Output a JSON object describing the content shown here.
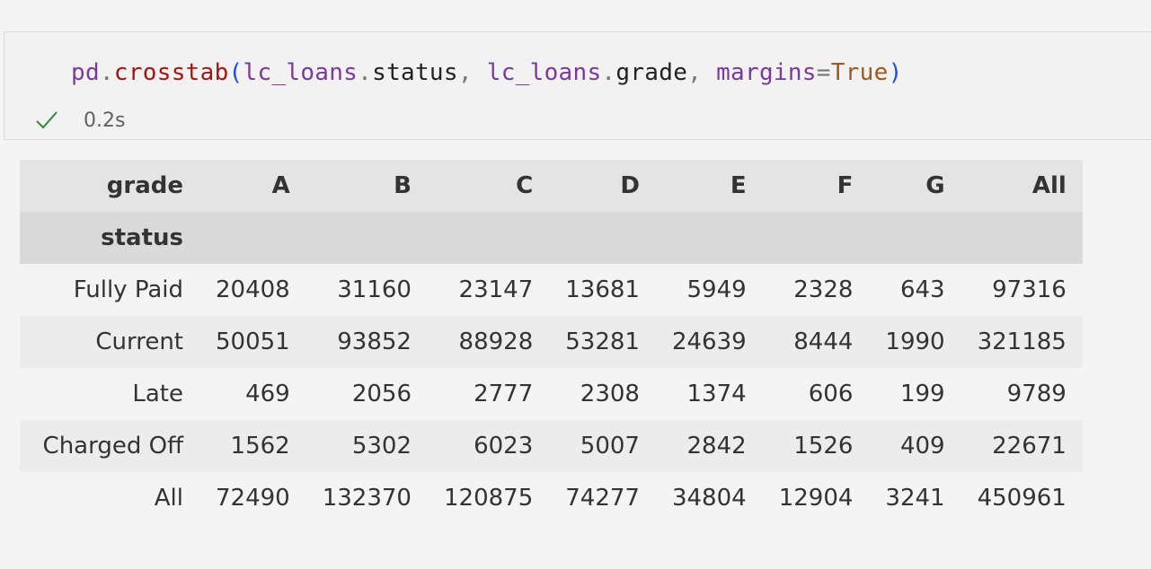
{
  "cell": {
    "code": {
      "obj": "pd",
      "dot1": ".",
      "func": "crosstab",
      "paren_open": "(",
      "arg1_obj": "lc_loans",
      "arg1_dot": ".",
      "arg1_attr": "status",
      "comma1": ", ",
      "arg2_obj": "lc_loans",
      "arg2_dot": ".",
      "arg2_attr": "grade",
      "comma2": ", ",
      "kwarg": "margins",
      "eq": "=",
      "kwval": "True",
      "paren_close": ")"
    },
    "status": {
      "icon": "check-icon",
      "timing": "0.2s"
    }
  },
  "table": {
    "col_index_label": "grade",
    "row_index_label": "status",
    "columns": [
      "A",
      "B",
      "C",
      "D",
      "E",
      "F",
      "G",
      "All"
    ],
    "rows": [
      {
        "label": "Fully Paid",
        "values": [
          "20408",
          "31160",
          "23147",
          "13681",
          "5949",
          "2328",
          "643",
          "97316"
        ]
      },
      {
        "label": "Current",
        "values": [
          "50051",
          "93852",
          "88928",
          "53281",
          "24639",
          "8444",
          "1990",
          "321185"
        ]
      },
      {
        "label": "Late",
        "values": [
          "469",
          "2056",
          "2777",
          "2308",
          "1374",
          "606",
          "199",
          "9789"
        ]
      },
      {
        "label": "Charged Off",
        "values": [
          "1562",
          "5302",
          "6023",
          "5007",
          "2842",
          "1526",
          "409",
          "22671"
        ]
      },
      {
        "label": "All",
        "values": [
          "72490",
          "132370",
          "120875",
          "74277",
          "34804",
          "12904",
          "3241",
          "450961"
        ]
      }
    ]
  },
  "colors": {
    "success": "#2e8b3a",
    "code_var": "#7b3a9a",
    "code_fn": "#a31515",
    "code_paren": "#1e4fd6",
    "code_bool": "#9a5b1e"
  }
}
